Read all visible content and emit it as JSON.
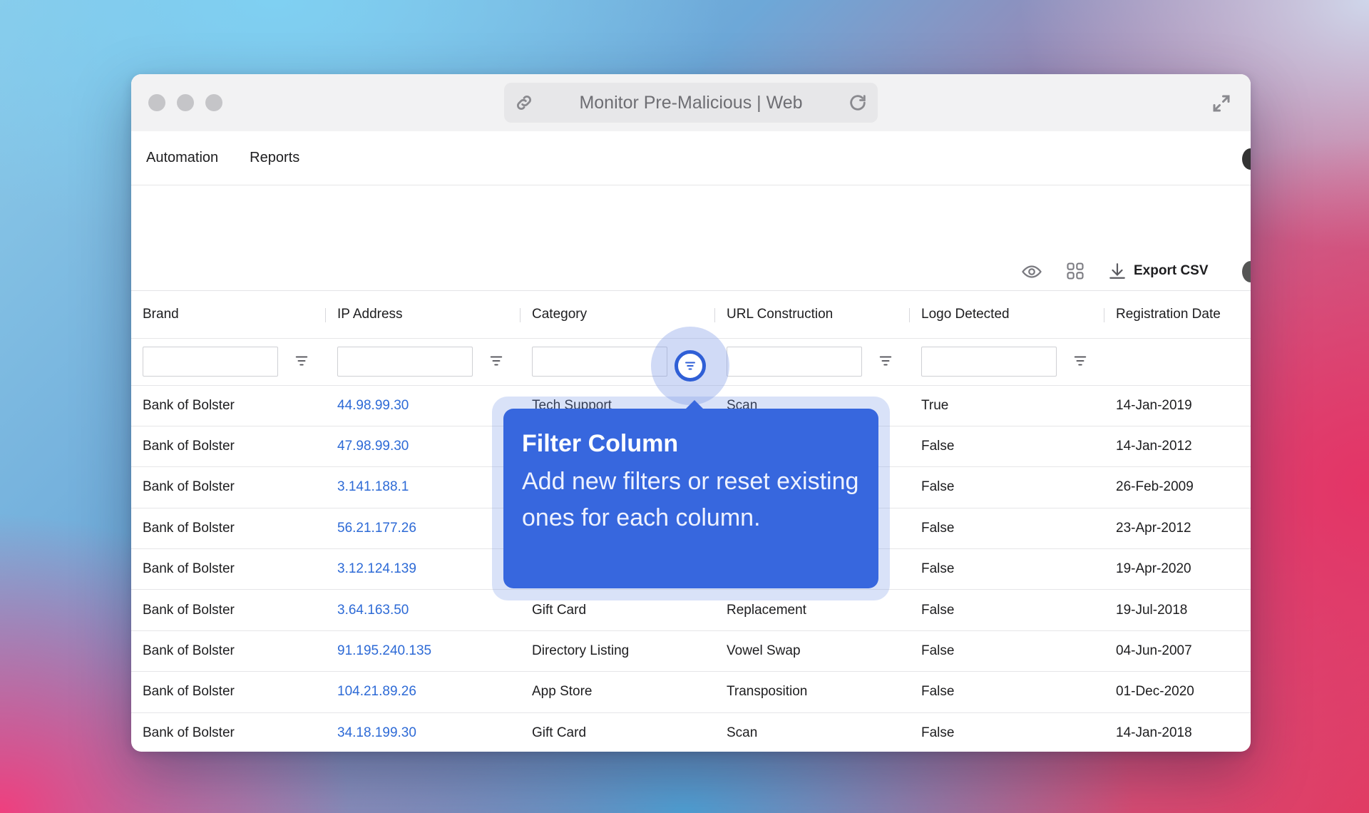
{
  "window": {
    "title": "Monitor Pre-Malicious | Web"
  },
  "nav": {
    "items": [
      "Automation",
      "Reports"
    ]
  },
  "toolbar": {
    "export_label": "Export CSV"
  },
  "table": {
    "columns": [
      "Brand",
      "IP Address",
      "Category",
      "URL Construction",
      "Logo Detected",
      "Registration Date"
    ],
    "rows": [
      [
        "Bank of Bolster",
        "44.98.99.30",
        "Tech Support",
        "Scan",
        "True",
        "14-Jan-2019"
      ],
      [
        "Bank of Bolster",
        "47.98.99.30",
        "",
        "",
        "False",
        "14-Jan-2012"
      ],
      [
        "Bank of Bolster",
        "3.141.188.1",
        "",
        "",
        "False",
        "26-Feb-2009"
      ],
      [
        "Bank of Bolster",
        "56.21.177.26",
        "",
        "",
        "False",
        "23-Apr-2012"
      ],
      [
        "Bank of Bolster",
        "3.12.124.139",
        "",
        "",
        "False",
        "19-Apr-2020"
      ],
      [
        "Bank of Bolster",
        "3.64.163.50",
        "Gift Card",
        "Replacement",
        "False",
        "19-Jul-2018"
      ],
      [
        "Bank of Bolster",
        "91.195.240.135",
        "Directory Listing",
        "Vowel Swap",
        "False",
        "04-Jun-2007"
      ],
      [
        "Bank of Bolster",
        "104.21.89.26",
        "App Store",
        "Transposition",
        "False",
        "01-Dec-2020"
      ],
      [
        "Bank of Bolster",
        "34.18.199.30",
        "Gift Card",
        "Scan",
        "False",
        "14-Jan-2018"
      ]
    ]
  },
  "tooltip": {
    "title": "Filter Column",
    "body": "Add new filters or reset existing ones for each column."
  },
  "colors": {
    "accent": "#3767de",
    "link": "#2d6ad6"
  }
}
